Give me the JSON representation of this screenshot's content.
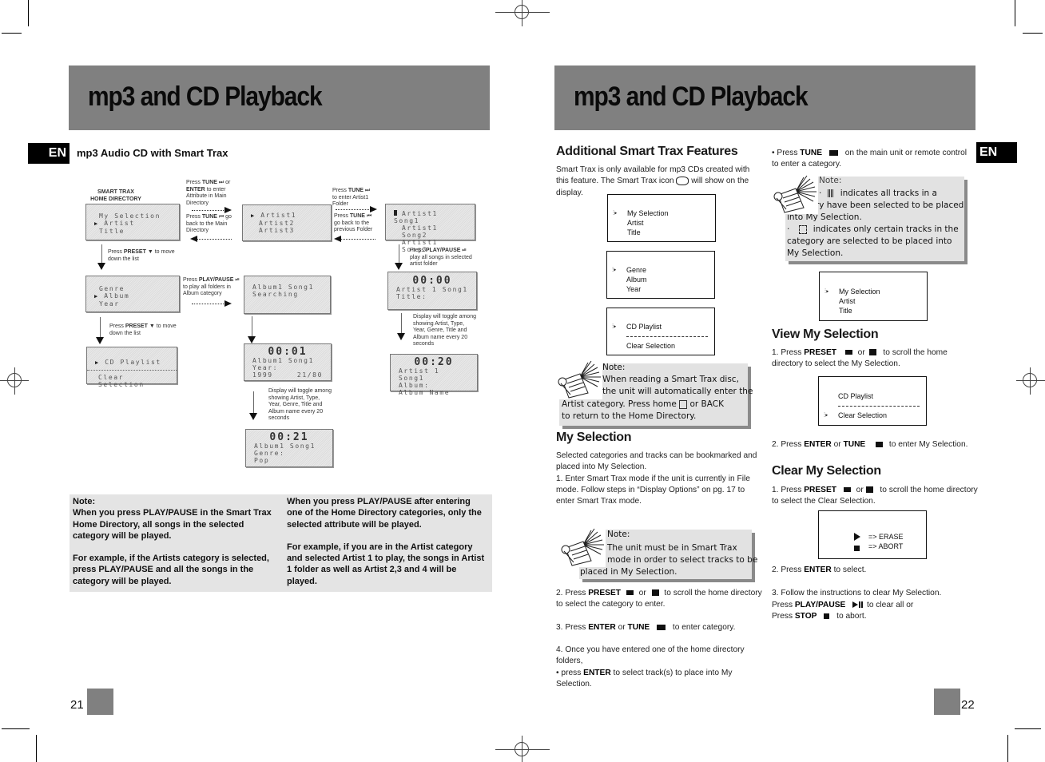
{
  "left_page": {
    "banner_title": "mp3 and CD Playback",
    "lang_tab": "EN",
    "section_title": "mp3 Audio CD with Smart Trax",
    "diagram": {
      "home_label": "SMART TRAX\nHOME DIRECTORY",
      "screens": {
        "home1": [
          "My Selection",
          "Artist",
          "Title"
        ],
        "home1_cursor_index": 1,
        "home2": [
          "Genre",
          "Album",
          "Year"
        ],
        "home2_cursor_index": 1,
        "home3": [
          "CD Playlist",
          "Clear Selection"
        ],
        "home3_cursor_index": 0,
        "artists": [
          "Artist1",
          "Artist2",
          "Artist3"
        ],
        "songs": [
          "Artist1 Song1",
          "Artist1 Song2",
          "Artist1 Song3"
        ],
        "album_search": [
          "Album1 Song1",
          "Searching"
        ],
        "play_0000": {
          "time": "00:00",
          "lines": [
            "Artist 1 Song1",
            "Title:"
          ]
        },
        "play_0020": {
          "time": "00:20",
          "lines": [
            "Artist 1 Song1",
            "Album:",
            "Album Name"
          ]
        },
        "play_0001": {
          "time": "00:01",
          "lines": [
            "Album1 Song1",
            "Year:"
          ],
          "year": "1999",
          "track": "21/80"
        },
        "play_0021": {
          "time": "00:21",
          "lines": [
            "Album1 Song1",
            "Genre:",
            "Pop"
          ]
        }
      },
      "labels": {
        "tune_enter_1": "Press",
        "tune_enter_key": "TUNE",
        "tune_enter_2": "or",
        "tune_enter_key2": "ENTER",
        "tune_enter_3": "to enter Attribute in Main Directory",
        "tune_back_1": "Press",
        "tune_back_key": "TUNE",
        "tune_back_2": "go back to the Main Directory",
        "tune_artist_1": "Press",
        "tune_artist_key": "TUNE",
        "tune_artist_2": "to enter Artist1 Folder",
        "tune_prev_1": "Press",
        "tune_prev_key": "TUNE",
        "tune_prev_2": "go back to the previous Folder",
        "preset_1_a": "Press",
        "preset_1_key": "PRESET",
        "preset_1_b": "to move down the list",
        "preset_2_a": "Press",
        "preset_2_key": "PRESET",
        "preset_2_b": "to move down the list",
        "play_album_a": "Press",
        "play_album_key": "PLAY/PAUSE",
        "play_album_b": "to play all folders in Album category",
        "play_artist_a": "Press",
        "play_artist_key": "PLAY/PAUSE",
        "play_artist_b": "play all songs in selected artist folder",
        "toggle_1": "Display will toggle among showing Artist, Type, Year, Genre, Title and Album name every 20 seconds",
        "toggle_2": "Display will toggle among showing Artist, Type, Year, Genre, Title and Album name every 20 seconds"
      }
    },
    "note": {
      "col1": [
        "Note:",
        "When you press PLAY/PAUSE in the Smart Trax Home Directory, all songs in the selected category will be played.",
        "For example, if the Artists category is selected, press PLAY/PAUSE and all the  songs in the category will be played."
      ],
      "col2": [
        "When you press PLAY/PAUSE after entering one of the Home Directory  categories, only the selected attribute will be played.",
        "For example, if you are in the Artist category and selected Artist 1 to play, the songs in Artist 1 folder as well as Artist 2,3 and 4 will be played."
      ]
    },
    "page_number": "21"
  },
  "right_page": {
    "banner_title": "mp3 and CD Playback",
    "lang_tab": "EN",
    "col1": {
      "h_additional": "Additional Smart Trax Features",
      "p_additional_1": "Smart Trax is only available for mp3 CDs created with this feature.  The Smart Trax icon",
      "p_additional_2": "will show on the display.",
      "box1": [
        "My Selection",
        "Artist",
        "Title"
      ],
      "box2": [
        "Genre",
        "Album",
        "Year"
      ],
      "box3": [
        "CD Playlist",
        "Clear Selection"
      ],
      "note1_title": "Note:",
      "note1_lines": [
        "When reading a Smart Trax disc,",
        "the unit will automatically enter the",
        "Artist category. Press home",
        "or BACK",
        "to return to the Home Directory."
      ],
      "h_my_selection": "My Selection",
      "p_my_selection": "Selected categories  and tracks can be bookmarked and placed into My Selection.",
      "p_step1": "1. Enter Smart Trax mode if the unit is currently in File mode.  Follow steps in “Display Options” on pg. 17 to enter Smart Trax mode.",
      "note2_title": "Note:",
      "note2_lines": [
        "The unit must be in Smart Trax",
        "mode in order to select tracks to be",
        "placed in My Selection."
      ],
      "step2_a": "2. Press",
      "step2_key": "PRESET",
      "step2_b": "or",
      "step2_c": "to scroll the home directory to select the category to enter.",
      "step3_a": "3.  Press",
      "step3_key1": "ENTER",
      "step3_b": "or",
      "step3_key2": "TUNE",
      "step3_c": "to enter category.",
      "step4": "4.  Once you have entered one of the home directory folders,",
      "step4_bullet_a": "•  press",
      "step4_bullet_key": "ENTER",
      "step4_bullet_b": "to select track(s) to place into  My Selection."
    },
    "col2": {
      "tune_a": "• Press",
      "tune_key": "TUNE",
      "tune_b": "on the main unit or remote  control to enter a category.",
      "note3_title": "Note:",
      "note3_line1": "indicates all tracks in a category have been selected to be placed into My Selection.",
      "note3_line2": "indicates only certain tracks in the category are selected to be placed into My Selection.",
      "box4": [
        "My Selection",
        "Artist",
        "Title"
      ],
      "h_view": "View My Selection",
      "view1_a": "1. Press",
      "view1_key": "PRESET",
      "view1_b": "or",
      "view1_c": "to scroll the home directory to select the My Selection.",
      "box5": [
        "CD Playlist",
        "Clear Selection"
      ],
      "view2_a": "2.  Press",
      "view2_key1": "ENTER",
      "view2_b": "or",
      "view2_key2": "TUNE",
      "view2_c": "to enter  My Selection.",
      "h_clear": "Clear My Selection",
      "clear1_a": "1. Press",
      "clear1_key": "PRESET",
      "clear1_b": "or",
      "clear1_c": "to scroll the home directory to select the Clear Selection.",
      "box6": [
        "=> ERASE",
        "=> ABORT"
      ],
      "clear2_a": "2.  Press",
      "clear2_key": "ENTER",
      "clear2_b": "to select.",
      "clear3": "3.  Follow the instructions to clear My Selection.",
      "clear3_play_a": "Press",
      "clear3_play_key": "PLAY/PAUSE",
      "clear3_play_b": "to clear all or",
      "clear3_stop_a": "Press",
      "clear3_stop_key": "STOP",
      "clear3_stop_b": "to abort."
    },
    "page_number": "22"
  },
  "colors": {
    "banner": "#808080",
    "note_bg": "#e4e4e4",
    "tab_bg": "#000000"
  }
}
